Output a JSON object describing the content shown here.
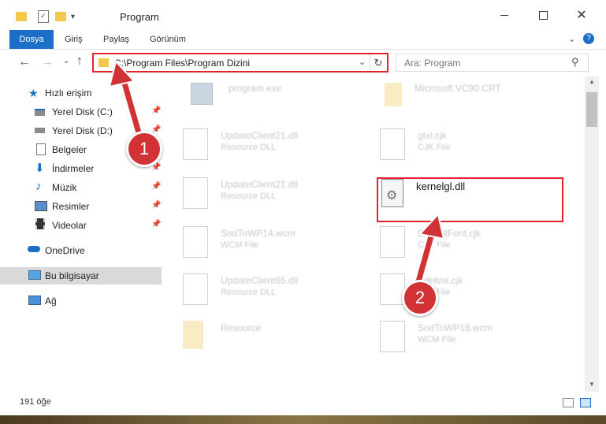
{
  "window": {
    "title": "Program"
  },
  "ribbon": {
    "tabs": [
      "Dosya",
      "Giriş",
      "Paylaş",
      "Görünüm"
    ]
  },
  "address": {
    "path": "C:\\Program Files\\Program Dizini"
  },
  "search": {
    "placeholder": "Ara: Program"
  },
  "sidebar": {
    "items": [
      {
        "label": "Hızlı erişim",
        "icon": "star-icon"
      },
      {
        "label": "Yerel Disk (C:)",
        "icon": "drive-icon",
        "pinned": true
      },
      {
        "label": "Yerel Disk (D:)",
        "icon": "drive-icon",
        "pinned": true
      },
      {
        "label": "Belgeler",
        "icon": "document-icon",
        "pinned": true
      },
      {
        "label": "İndirmeler",
        "icon": "download-icon",
        "pinned": true
      },
      {
        "label": "Müzik",
        "icon": "music-icon",
        "pinned": true
      },
      {
        "label": "Resimler",
        "icon": "pictures-icon",
        "pinned": true
      },
      {
        "label": "Videolar",
        "icon": "video-icon",
        "pinned": true
      },
      {
        "label": "OneDrive",
        "icon": "cloud-icon"
      },
      {
        "label": "Bu bilgisayar",
        "icon": "computer-icon",
        "selected": true
      },
      {
        "label": "Ağ",
        "icon": "network-icon"
      }
    ]
  },
  "files": [
    {
      "name": "program.exe",
      "type": ""
    },
    {
      "name": "Microsoft.VC90.CRT",
      "type": ""
    },
    {
      "name": "UpdateClient21.dll",
      "type": "Resource DLL"
    },
    {
      "name": "gtxl.cjk",
      "type": "CJK File"
    },
    {
      "name": "UpdateClient21.dll",
      "type": "Resource DLL"
    },
    {
      "name": "kernelgl.dll",
      "type": ""
    },
    {
      "name": "SndToWP14.wcm",
      "type": "WCM File"
    },
    {
      "name": "DefaultFont.cjk",
      "type": "CJK File"
    },
    {
      "name": "UpdateClient65.dll",
      "type": "Resource DLL"
    },
    {
      "name": "EdHtml.cjk",
      "type": "CJK File"
    },
    {
      "name": "Resource",
      "type": ""
    },
    {
      "name": "SndToWP18.wcm",
      "type": "WCM File"
    }
  ],
  "status": {
    "count": "191 öğe"
  },
  "annotations": {
    "step1": "1",
    "step2": "2"
  },
  "colors": {
    "accent": "#1b6fc7",
    "highlight": "#e2252b",
    "badge": "#d03235"
  }
}
